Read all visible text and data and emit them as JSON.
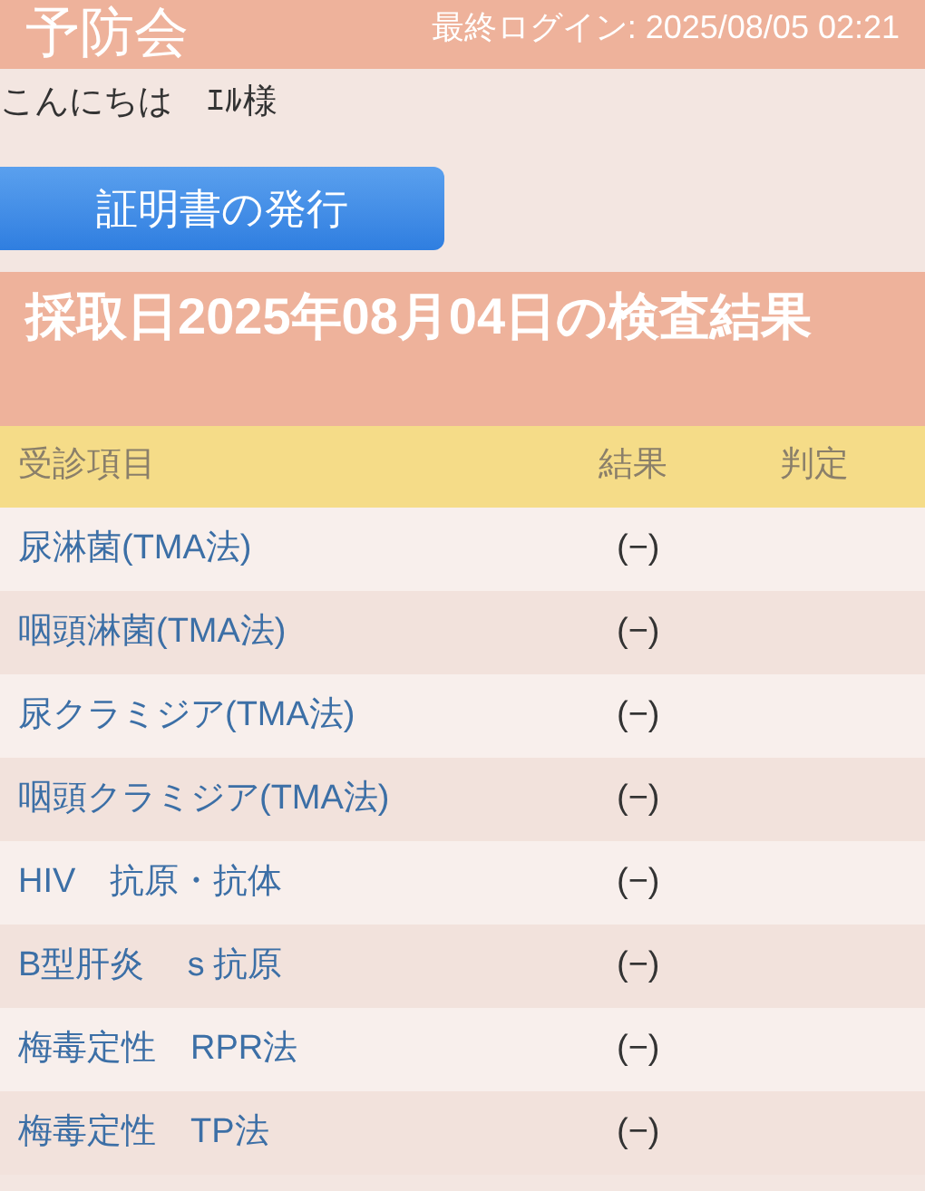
{
  "header": {
    "title": "予防会",
    "last_login": "最終ログイン: 2025/08/05 02:21"
  },
  "greeting": "こんにちは　ｴﾙ様",
  "certificate_button": "証明書の発行",
  "section_title": "採取日2025年08月04日の検査結果",
  "table": {
    "columns": [
      "受診項目",
      "結果",
      "判定"
    ],
    "rows": [
      {
        "item": "尿淋菌(TMA法)",
        "result": "(−)"
      },
      {
        "item": "咽頭淋菌(TMA法)",
        "result": "(−)"
      },
      {
        "item": "尿クラミジア(TMA法)",
        "result": "(−)"
      },
      {
        "item": "咽頭クラミジア(TMA法)",
        "result": "(−)"
      },
      {
        "item": "HIV　抗原・抗体",
        "result": "(−)"
      },
      {
        "item": "B型肝炎　ｓ抗原",
        "result": "(−)"
      },
      {
        "item": "梅毒定性　RPR法",
        "result": "(−)"
      },
      {
        "item": "梅毒定性　TP法",
        "result": "(−)"
      }
    ]
  }
}
